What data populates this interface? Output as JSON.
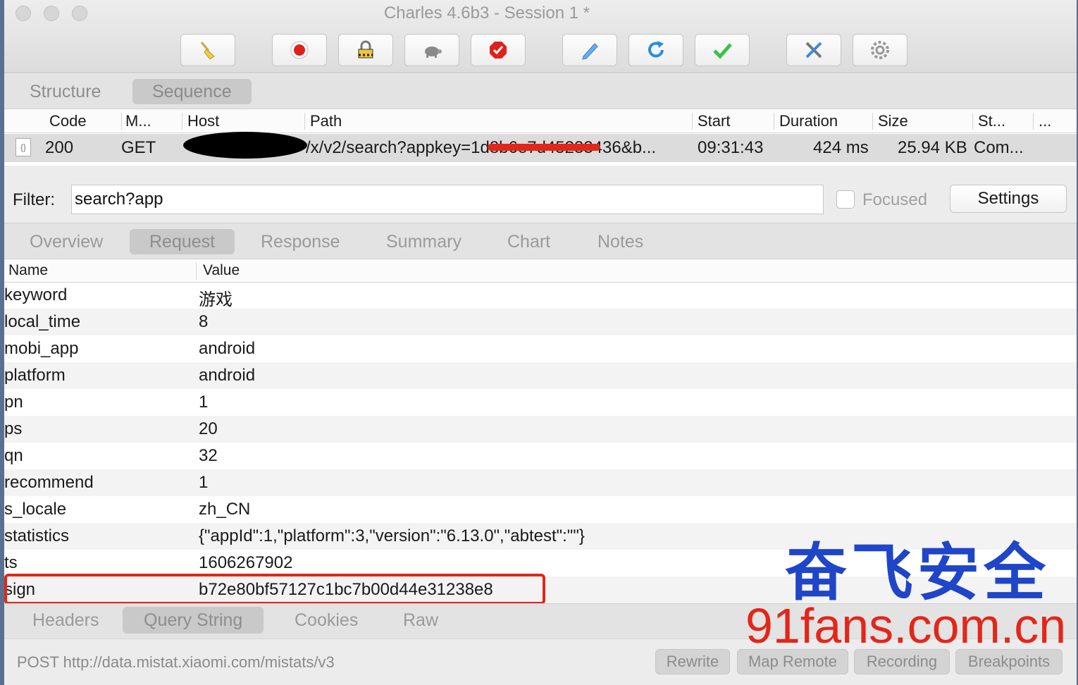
{
  "window": {
    "title": "Charles 4.6b3 - Session 1 *"
  },
  "toolbar": {
    "buttons": [
      {
        "icon": "broom-icon"
      },
      {
        "icon": "record-icon"
      },
      {
        "icon": "ssl-lock-icon"
      },
      {
        "icon": "throttle-turtle-icon"
      },
      {
        "icon": "breakpoint-stop-icon"
      },
      {
        "icon": "compose-pen-icon"
      },
      {
        "icon": "repeat-icon"
      },
      {
        "icon": "validate-check-icon"
      },
      {
        "icon": "tools-icon"
      },
      {
        "icon": "settings-gear-icon"
      }
    ]
  },
  "view_tabs": {
    "structure": "Structure",
    "sequence": "Sequence",
    "active": "Sequence"
  },
  "sequence": {
    "columns": [
      "Code",
      "M...",
      "Host",
      "Path",
      "Start",
      "Duration",
      "Size",
      "St...",
      "..."
    ],
    "row": {
      "code": "200",
      "method": "GET",
      "path": "/x/v2/search?appkey=1d8b6e7d45233436&b...",
      "start": "09:31:43",
      "duration": "424 ms",
      "size": "25.94 KB",
      "status": "Com..."
    }
  },
  "filter": {
    "label": "Filter:",
    "value": "search?app",
    "focused_label": "Focused",
    "focused_checked": false,
    "settings_label": "Settings"
  },
  "detail_tabs": {
    "items": [
      "Overview",
      "Request",
      "Response",
      "Summary",
      "Chart",
      "Notes"
    ],
    "active": "Request"
  },
  "params": {
    "header_name": "Name",
    "header_value": "Value",
    "rows": [
      {
        "name": "keyword",
        "value": "游戏"
      },
      {
        "name": "local_time",
        "value": "8"
      },
      {
        "name": "mobi_app",
        "value": "android"
      },
      {
        "name": "platform",
        "value": "android"
      },
      {
        "name": "pn",
        "value": "1"
      },
      {
        "name": "ps",
        "value": "20"
      },
      {
        "name": "qn",
        "value": "32"
      },
      {
        "name": "recommend",
        "value": "1"
      },
      {
        "name": "s_locale",
        "value": "zh_CN"
      },
      {
        "name": "statistics",
        "value": "{\"appId\":1,\"platform\":3,\"version\":\"6.13.0\",\"abtest\":\"\"}"
      },
      {
        "name": "ts",
        "value": "1606267902"
      },
      {
        "name": "sign",
        "value": "b72e80bf57127c1bc7b00d44e31238e8"
      }
    ]
  },
  "watermark": {
    "chinese": "奋飞安全",
    "url": "91fans.com.cn"
  },
  "bottom_tabs": {
    "items": [
      "Headers",
      "Query String",
      "Cookies",
      "Raw"
    ],
    "active": "Query String"
  },
  "status": {
    "text": "POST http://data.mistat.xiaomi.com/mistats/v3",
    "buttons": [
      "Rewrite",
      "Map Remote",
      "Recording",
      "Breakpoints"
    ]
  },
  "colors": {
    "annotation_red": "#e3261a",
    "watermark_blue": "#1f45c8"
  }
}
